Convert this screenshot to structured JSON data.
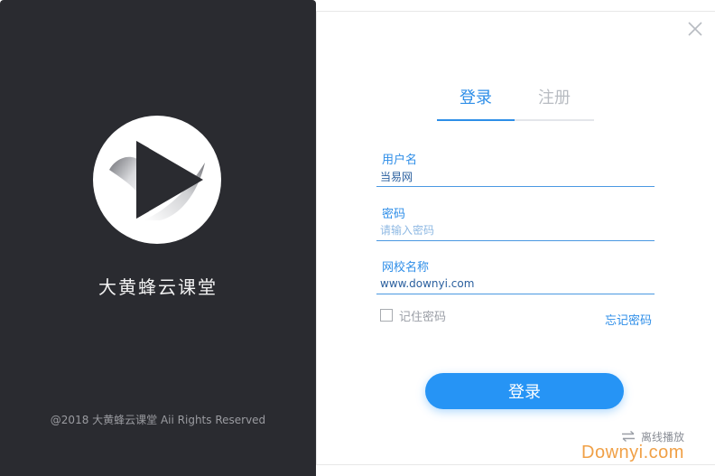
{
  "brand": {
    "app_name": "大黄蜂云课堂",
    "copyright": "@2018 大黄蜂云课堂 Aii Rights Reserved"
  },
  "tabs": [
    {
      "label": "登录",
      "active": true
    },
    {
      "label": "注册",
      "active": false
    }
  ],
  "form": {
    "username": {
      "label": "用户名",
      "value": "当易网",
      "placeholder": ""
    },
    "password": {
      "label": "密码",
      "value": "",
      "placeholder": "请输入密码"
    },
    "school": {
      "label": "网校名称",
      "value": "www.downyi.com",
      "placeholder": ""
    },
    "remember_label": "记住密码",
    "remember_checked": false,
    "forgot_label": "忘记密码"
  },
  "login_button": "登录",
  "offline_label": "离线播放",
  "watermark": "Downyi.com",
  "colors": {
    "accent": "#2e8ee8",
    "left_panel": "#2a2b30",
    "button": "#2694f5"
  }
}
